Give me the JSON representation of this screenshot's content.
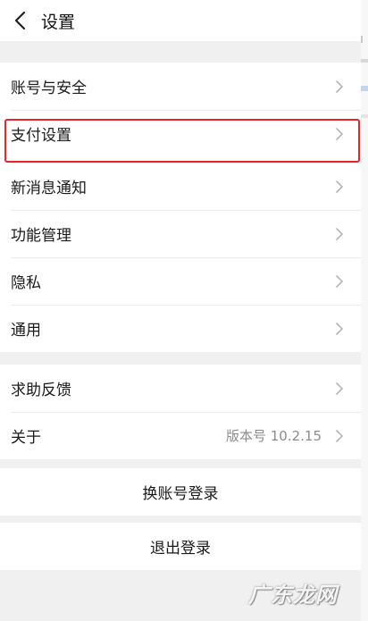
{
  "header": {
    "title": "设置"
  },
  "settings_group_1": [
    {
      "label": "账号与安全"
    },
    {
      "label": "支付设置"
    },
    {
      "label": "新消息通知"
    },
    {
      "label": "功能管理"
    },
    {
      "label": "隐私"
    },
    {
      "label": "通用"
    }
  ],
  "settings_group_2": [
    {
      "label": "求助反馈"
    },
    {
      "label": "关于",
      "value": "版本号 10.2.15"
    }
  ],
  "actions": {
    "switch_account": "换账号登录",
    "logout": "退出登录"
  },
  "watermark": "广东龙网",
  "colors": {
    "highlight": "#e6262b",
    "background": "#f0f0f0",
    "chevron": "#b5b5b5"
  },
  "icons": {
    "back": "back-arrow-icon",
    "chevron": "chevron-right-icon"
  }
}
